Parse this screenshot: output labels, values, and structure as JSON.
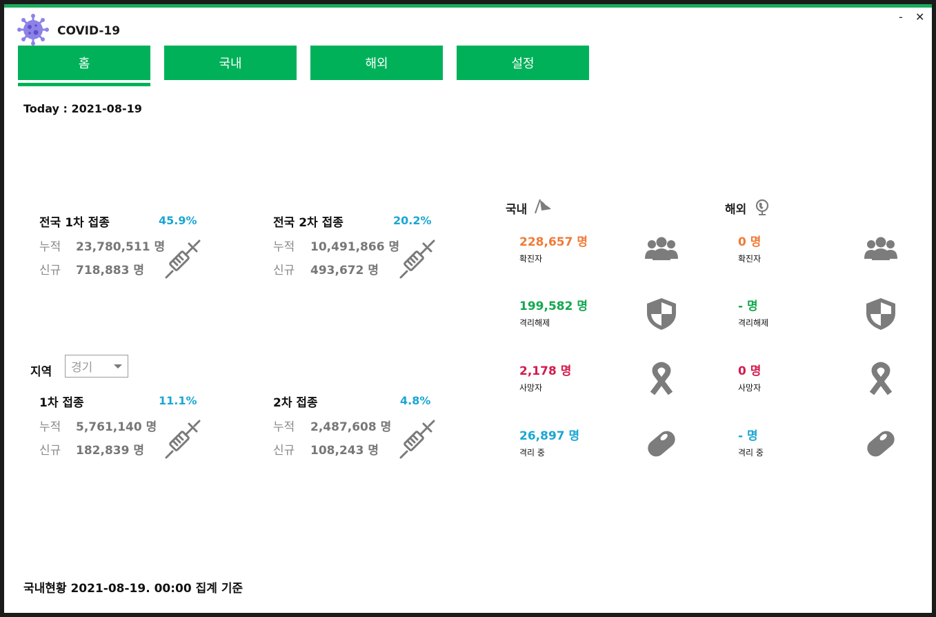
{
  "app": {
    "title": "COVID-19",
    "minimize": "-",
    "close": "✕"
  },
  "tabs": [
    "홈",
    "국내",
    "해외",
    "설정"
  ],
  "today": "Today : 2021-08-19",
  "national": {
    "dose1": {
      "title": "전국 1차 접종",
      "pct": "45.9%",
      "total_label": "누적",
      "total": "23,780,511 명",
      "new_label": "신규",
      "new": "718,883 명"
    },
    "dose2": {
      "title": "전국 2차 접종",
      "pct": "20.2%",
      "total_label": "누적",
      "total": "10,491,866 명",
      "new_label": "신규",
      "new": "493,672 명"
    }
  },
  "region": {
    "label": "지역",
    "selected": "경기",
    "dose1": {
      "title": "1차 접종",
      "pct": "11.1%",
      "total_label": "누적",
      "total": "5,761,140 명",
      "new_label": "신규",
      "new": "182,839 명"
    },
    "dose2": {
      "title": "2차 접종",
      "pct": "4.8%",
      "total_label": "누적",
      "total": "2,487,608 명",
      "new_label": "신규",
      "new": "108,243 명"
    }
  },
  "domestic": {
    "title": "국내",
    "stats": [
      {
        "value": "228,657 명",
        "label": "확진자",
        "color": "#f07a36",
        "icon": "people-icon"
      },
      {
        "value": "199,582 명",
        "label": "격리해제",
        "color": "#12a84e",
        "icon": "shield-icon"
      },
      {
        "value": "2,178 명",
        "label": "사망자",
        "color": "#d41a4c",
        "icon": "ribbon-icon"
      },
      {
        "value": "26,897 명",
        "label": "격리 중",
        "color": "#1aa6d4",
        "icon": "pill-icon"
      }
    ]
  },
  "overseas": {
    "title": "해외",
    "stats": [
      {
        "value": "0 명",
        "label": "확진자",
        "color": "#f07a36",
        "icon": "people-icon"
      },
      {
        "value": "- 명",
        "label": "격리해제",
        "color": "#12a84e",
        "icon": "shield-icon"
      },
      {
        "value": "0 명",
        "label": "사망자",
        "color": "#d41a4c",
        "icon": "ribbon-icon"
      },
      {
        "value": "- 명",
        "label": "격리 중",
        "color": "#1aa6d4",
        "icon": "pill-icon"
      }
    ]
  },
  "footer": "국내현황 2021-08-19. 00:00 집계 기준"
}
